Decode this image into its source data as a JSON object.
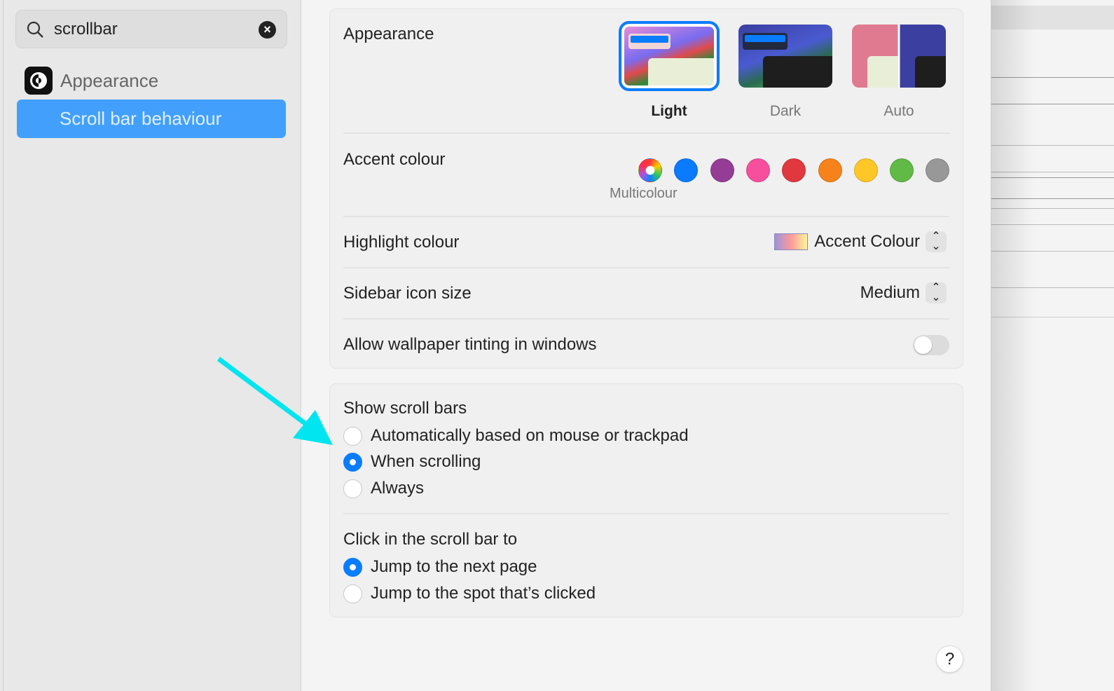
{
  "search": {
    "value": "scrollbar",
    "clear_label": "×"
  },
  "results": {
    "app": "Appearance",
    "item": "Scroll bar behaviour"
  },
  "appearance": {
    "label": "Appearance",
    "themes": [
      {
        "name": "Light",
        "selected": true
      },
      {
        "name": "Dark",
        "selected": false
      },
      {
        "name": "Auto",
        "selected": false
      }
    ]
  },
  "accent": {
    "label": "Accent colour",
    "selected_name": "Multicolour",
    "colors": [
      "multicolour",
      "#0a7aff",
      "#953d96",
      "#f74f9e",
      "#e0383e",
      "#f7821b",
      "#ffc726",
      "#62ba46",
      "#989898"
    ]
  },
  "highlight": {
    "label": "Highlight colour",
    "value": "Accent Colour"
  },
  "sidebar_icon": {
    "label": "Sidebar icon size",
    "value": "Medium"
  },
  "tinting": {
    "label": "Allow wallpaper tinting in windows",
    "on": false
  },
  "show_scroll": {
    "label": "Show scroll bars",
    "options": [
      "Automatically based on mouse or trackpad",
      "When scrolling",
      "Always"
    ],
    "selected": 1
  },
  "click_scroll": {
    "label": "Click in the scroll bar to",
    "options": [
      "Jump to the next page",
      "Jump to the spot that’s clicked"
    ],
    "selected": 0
  },
  "help": {
    "label": "?"
  },
  "annotation": {
    "arrow_color": "#00e5f0"
  }
}
